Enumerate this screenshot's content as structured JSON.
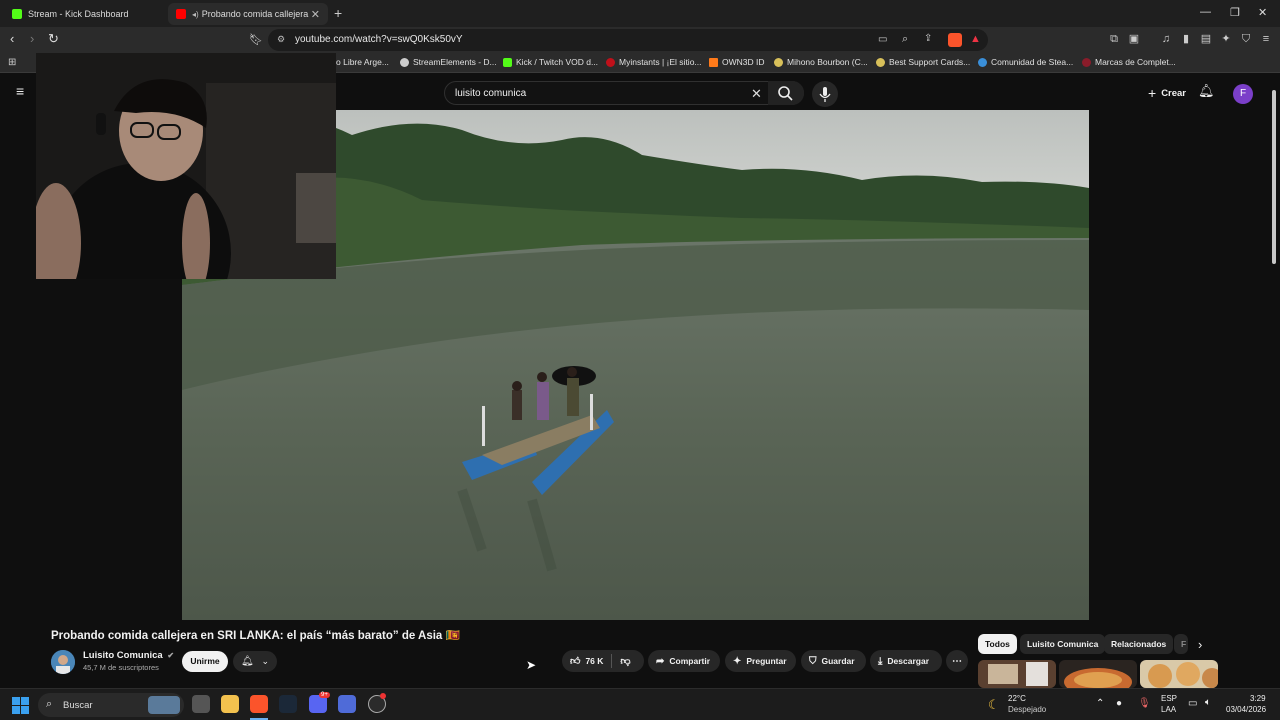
{
  "browser": {
    "tabs": [
      {
        "title": "Stream - Kick Dashboard",
        "active": false,
        "favicon": "kick-icon"
      },
      {
        "title": "Probando comida callejera en",
        "active": true,
        "favicon": "youtube-icon"
      }
    ],
    "url": "youtube.com/watch?v=swQ0Ksk50vY",
    "bookmarks": [
      {
        "label": "o Libre Arge..."
      },
      {
        "label": "StreamElements - D..."
      },
      {
        "label": "Kick / Twitch VOD d..."
      },
      {
        "label": "Myinstants | ¡El sitio..."
      },
      {
        "label": "OWN3D ID"
      },
      {
        "label": "Mihono Bourbon (C..."
      },
      {
        "label": "Best Support Cards..."
      },
      {
        "label": "Comunidad de Stea..."
      },
      {
        "label": "Marcas de Complet..."
      }
    ]
  },
  "youtube": {
    "search_value": "luisito comunica",
    "create_label": "Crear",
    "avatar_letter": "F",
    "video_title": "Probando comida callejera en SRI LANKA: el país “más barato” de Asia 🇱🇰",
    "channel_name": "Luisito Comunica",
    "subscribers": "45,7 M de suscriptores",
    "join_label": "Unirme",
    "actions": {
      "likes": "76 K",
      "share": "Compartir",
      "ask": "Preguntar",
      "save": "Guardar",
      "download": "Descargar"
    },
    "chips": [
      "Todos",
      "Luisito Comunica",
      "Relacionados",
      "F"
    ]
  },
  "taskbar": {
    "search_placeholder": "Buscar",
    "weather_temp": "22°C",
    "weather_desc": "Despejado",
    "lang": "ESP",
    "layout": "LAA",
    "time": "3:29",
    "date": "03/04/2026",
    "discord_badge": "9+"
  },
  "colors": {
    "yt_bg": "#0f0f0f",
    "kick_green": "#53fc18",
    "youtube_red": "#ff0000",
    "avatar_purple": "#7b3fc9"
  }
}
